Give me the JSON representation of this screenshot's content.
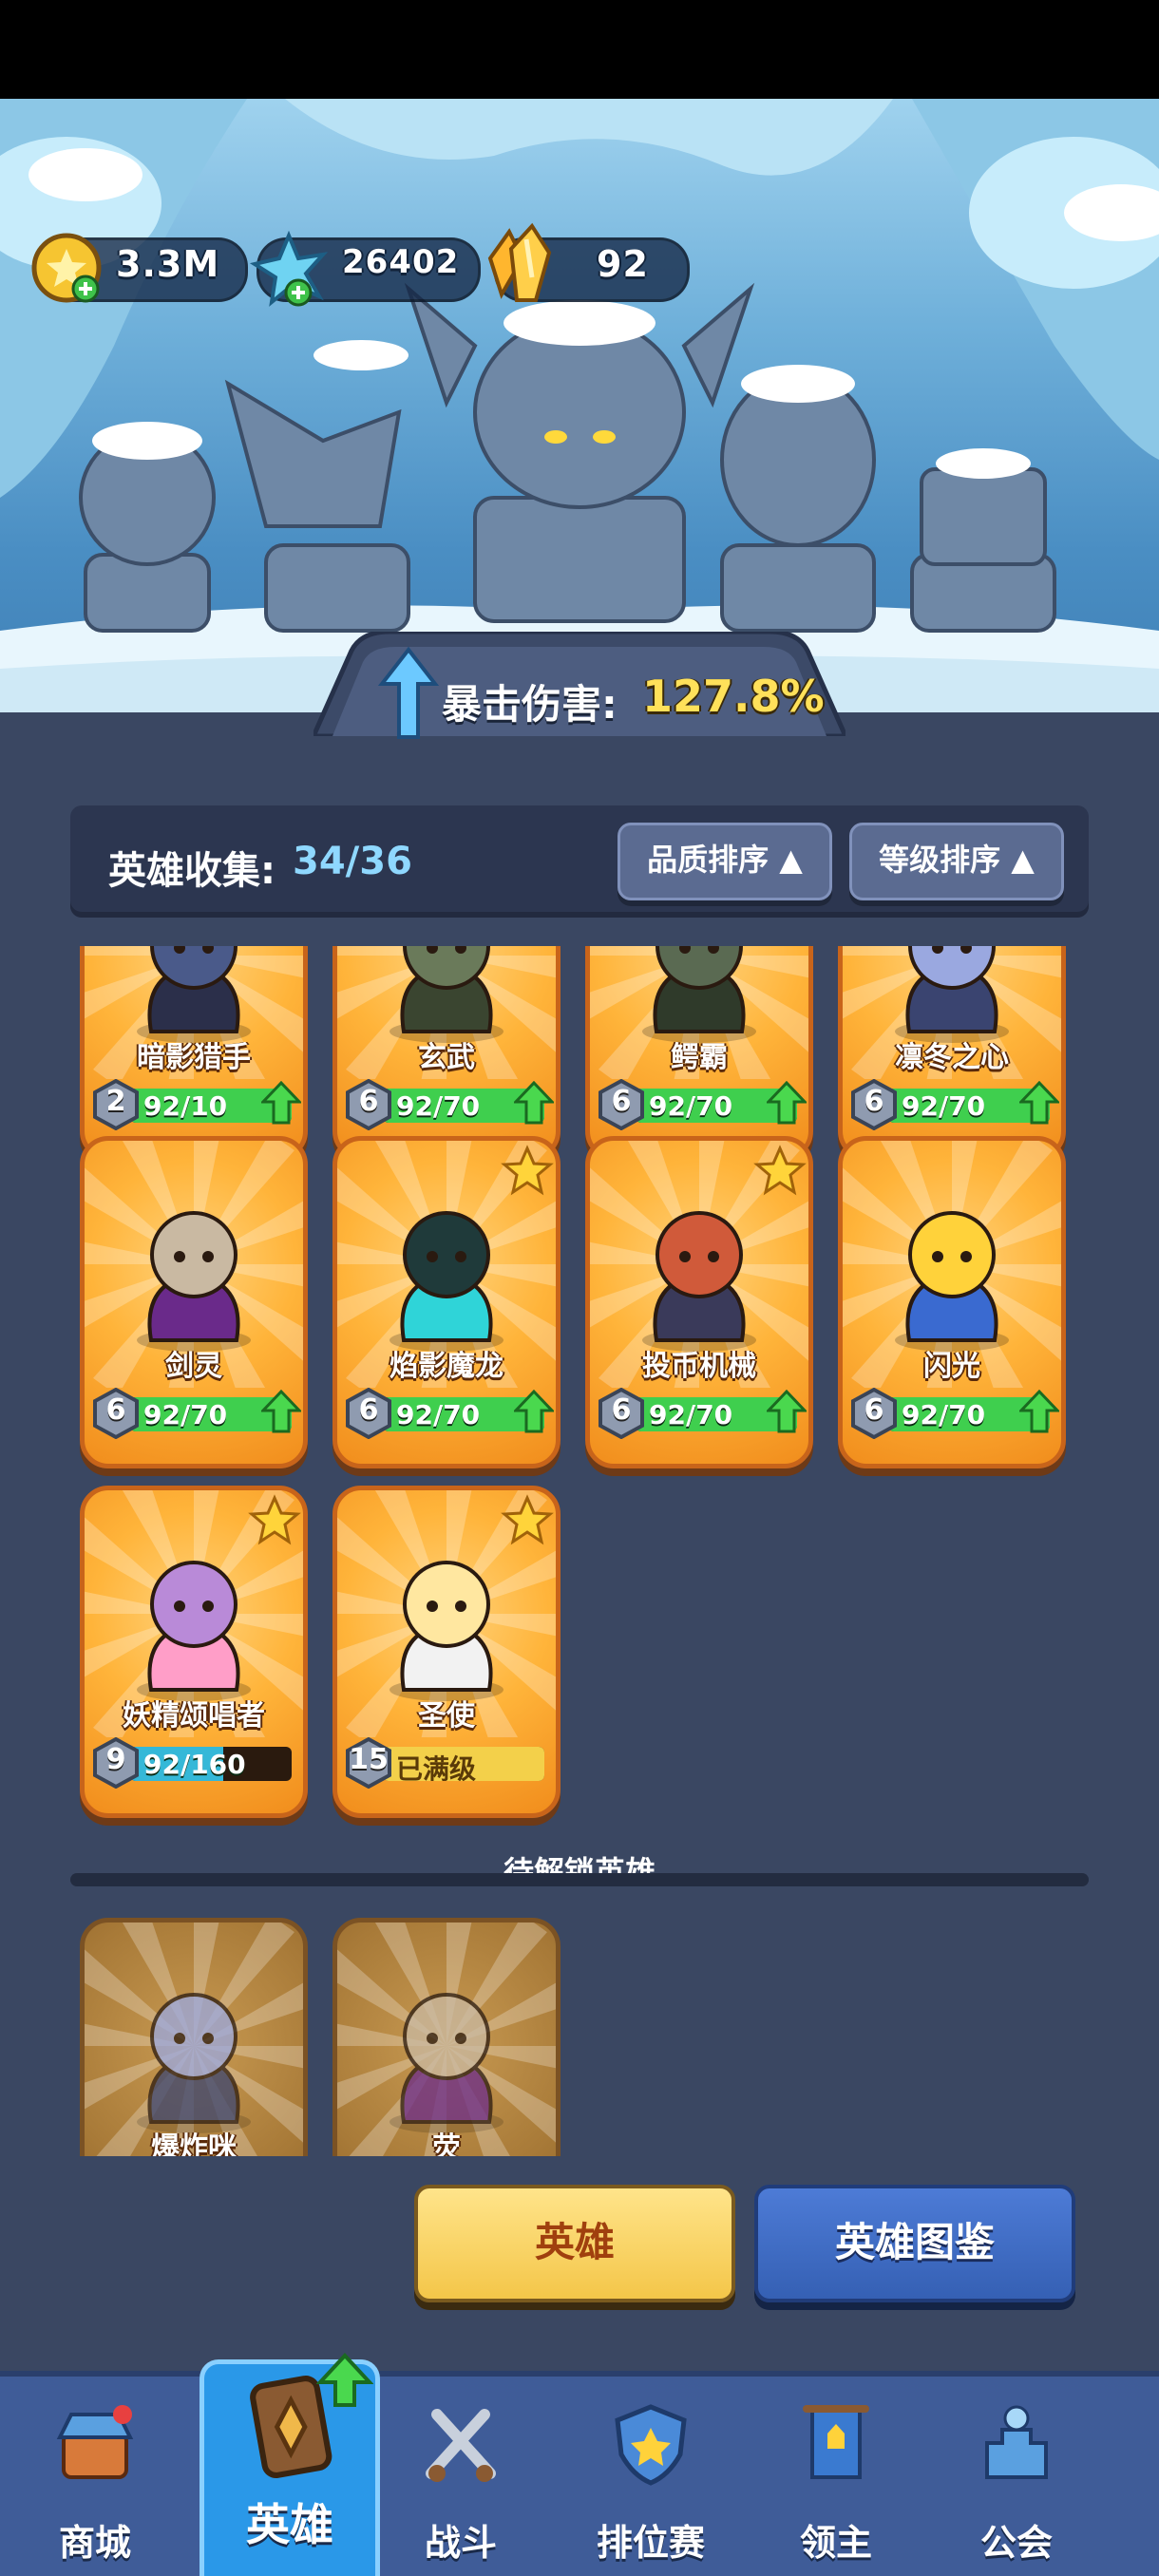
{
  "resources": {
    "gold": {
      "value": "3.3M",
      "icon": "gold-coin-icon"
    },
    "crystal": {
      "value": "26402",
      "icon": "blue-crystal-icon"
    },
    "amber": {
      "value": "92",
      "icon": "amber-crystal-icon"
    }
  },
  "crit_bonus": {
    "label": "暴击伤害:",
    "value": "127.8%"
  },
  "collection": {
    "label": "英雄收集:",
    "count": "34/36"
  },
  "sort": {
    "quality": "品质排序 ▲",
    "level": "等级排序 ▲"
  },
  "heroes": [
    {
      "name": "暗影猎手",
      "level": "2",
      "progress": "92/10",
      "fill": 1.0,
      "bar": "green",
      "upgrade": true,
      "star": false
    },
    {
      "name": "玄武",
      "level": "6",
      "progress": "92/70",
      "fill": 1.0,
      "bar": "green",
      "upgrade": true,
      "star": false
    },
    {
      "name": "鳄霸",
      "level": "6",
      "progress": "92/70",
      "fill": 1.0,
      "bar": "green",
      "upgrade": true,
      "star": false
    },
    {
      "name": "凛冬之心",
      "level": "6",
      "progress": "92/70",
      "fill": 1.0,
      "bar": "green",
      "upgrade": true,
      "star": false
    },
    {
      "name": "剑灵",
      "level": "6",
      "progress": "92/70",
      "fill": 1.0,
      "bar": "green",
      "upgrade": true,
      "star": false
    },
    {
      "name": "焰影魔龙",
      "level": "6",
      "progress": "92/70",
      "fill": 1.0,
      "bar": "green",
      "upgrade": true,
      "star": true
    },
    {
      "name": "投币机械",
      "level": "6",
      "progress": "92/70",
      "fill": 1.0,
      "bar": "green",
      "upgrade": true,
      "star": true
    },
    {
      "name": "闪光",
      "level": "6",
      "progress": "92/70",
      "fill": 1.0,
      "bar": "green",
      "upgrade": true,
      "star": false
    },
    {
      "name": "妖精颂唱者",
      "level": "9",
      "progress": "92/160",
      "fill": 0.575,
      "bar": "cyan",
      "upgrade": false,
      "star": true
    },
    {
      "name": "圣使",
      "level": "15",
      "progress": "已满级",
      "fill": 1.0,
      "bar": "gold",
      "upgrade": false,
      "star": true
    }
  ],
  "locked": {
    "title": "待解锁英雄",
    "heroes": [
      {
        "name": "爆炸咪"
      },
      {
        "name": "荧"
      }
    ]
  },
  "actions": {
    "heroes": "英雄",
    "codex": "英雄图鉴"
  },
  "nav": [
    {
      "label": "商城",
      "icon": "shop-icon"
    },
    {
      "label": "英雄",
      "icon": "hero-card-icon"
    },
    {
      "label": "战斗",
      "icon": "crossed-swords-icon"
    },
    {
      "label": "排位赛",
      "icon": "rank-shield-icon"
    },
    {
      "label": "领主",
      "icon": "lord-banner-icon"
    },
    {
      "label": "公会",
      "icon": "guild-castle-icon"
    }
  ],
  "colors": {
    "bar_green": "#3fcf4e",
    "bar_cyan": "#35b8d8",
    "bar_gold": "#f3d04a",
    "card_orange": "#f7a12b"
  }
}
